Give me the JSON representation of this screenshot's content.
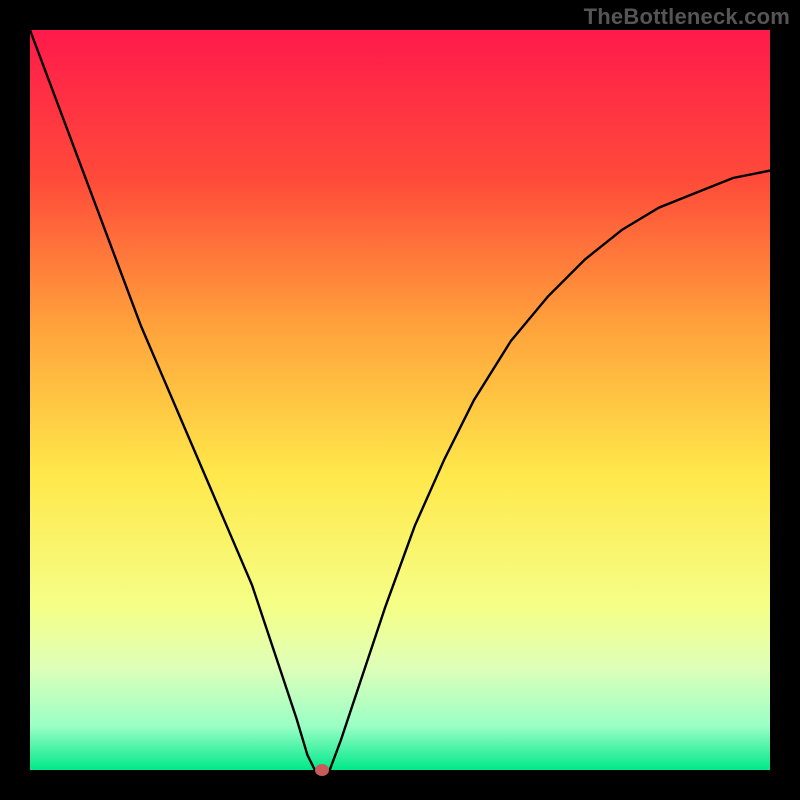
{
  "watermark": "TheBottleneck.com",
  "chart_data": {
    "type": "line",
    "title": "",
    "xlabel": "",
    "ylabel": "",
    "xlim": [
      0,
      100
    ],
    "ylim": [
      0,
      100
    ],
    "grid": false,
    "legend": false,
    "background_gradient": {
      "direction": "vertical",
      "stops": [
        {
          "pos": 0.0,
          "color": "#ff1a4b"
        },
        {
          "pos": 0.2,
          "color": "#ff4a3a"
        },
        {
          "pos": 0.4,
          "color": "#ffa23b"
        },
        {
          "pos": 0.6,
          "color": "#ffe84a"
        },
        {
          "pos": 0.78,
          "color": "#f5ff88"
        },
        {
          "pos": 0.86,
          "color": "#dfffb8"
        },
        {
          "pos": 0.94,
          "color": "#9bffc6"
        },
        {
          "pos": 1.0,
          "color": "#00e88a"
        }
      ]
    },
    "series": [
      {
        "name": "curve",
        "color": "#000000",
        "x": [
          0,
          3,
          6,
          9,
          12,
          15,
          18,
          21,
          24,
          27,
          30,
          32,
          34,
          36,
          37.5,
          38.5,
          40.5,
          42,
          45,
          48,
          52,
          56,
          60,
          65,
          70,
          75,
          80,
          85,
          90,
          95,
          100
        ],
        "y": [
          100,
          92,
          84,
          76,
          68,
          60,
          53,
          46,
          39,
          32,
          25,
          19,
          13,
          7,
          2,
          0,
          0,
          4,
          13,
          22,
          33,
          42,
          50,
          58,
          64,
          69,
          73,
          76,
          78,
          80,
          81
        ]
      }
    ],
    "marker": {
      "x": 39.5,
      "y": 0,
      "color": "#c85a5a"
    }
  }
}
